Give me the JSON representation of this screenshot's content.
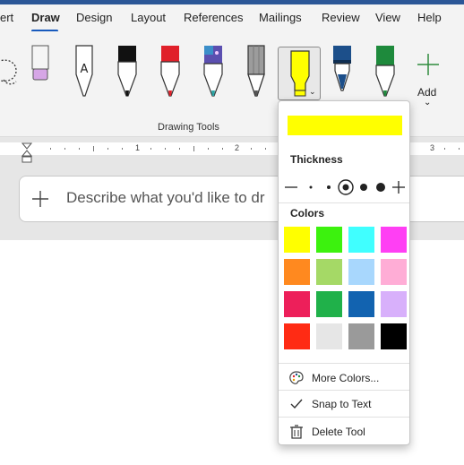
{
  "ribbon_tabs": {
    "insert_partial": "ert",
    "draw": "Draw",
    "design": "Design",
    "layout": "Layout",
    "references": "References",
    "mailings": "Mailings",
    "review": "Review",
    "view": "View",
    "help": "Help"
  },
  "ribbon": {
    "group_label": "Drawing Tools",
    "add_label": "Add",
    "pen_colors": {
      "eraser": "#d6a6e6",
      "pencil_text": "A",
      "black_pen": "#111111",
      "red_pen": "#e0202a",
      "galaxy_pen": "#5b4fb0",
      "gray_pencil": "#8a8a8a",
      "highlighter": "#ffff00",
      "blue_fountain_pen": "#1c4f8a",
      "green_pen": "#1e8a3c"
    }
  },
  "ruler": {
    "marks": [
      "1",
      "2",
      "3"
    ]
  },
  "prompt": {
    "placeholder": "Describe what you'd like to dr"
  },
  "popup": {
    "selected_color": "#ffff00",
    "thickness_title": "Thickness",
    "colors_title": "Colors",
    "colors": [
      [
        "#ffff00",
        "#3cf20e",
        "#40ffff",
        "#ff3ff4"
      ],
      [
        "#ff891f",
        "#a5d966",
        "#a8d7fd",
        "#ffadd6"
      ],
      [
        "#ed1f5a",
        "#20b14a",
        "#1263b0",
        "#d8b0fb"
      ],
      [
        "#ff2b14",
        "#e6e6e6",
        "#9a9a9a",
        "#000000"
      ]
    ],
    "more_colors": "More Colors...",
    "snap_to_text": "Snap to Text",
    "delete_tool": "Delete Tool"
  }
}
